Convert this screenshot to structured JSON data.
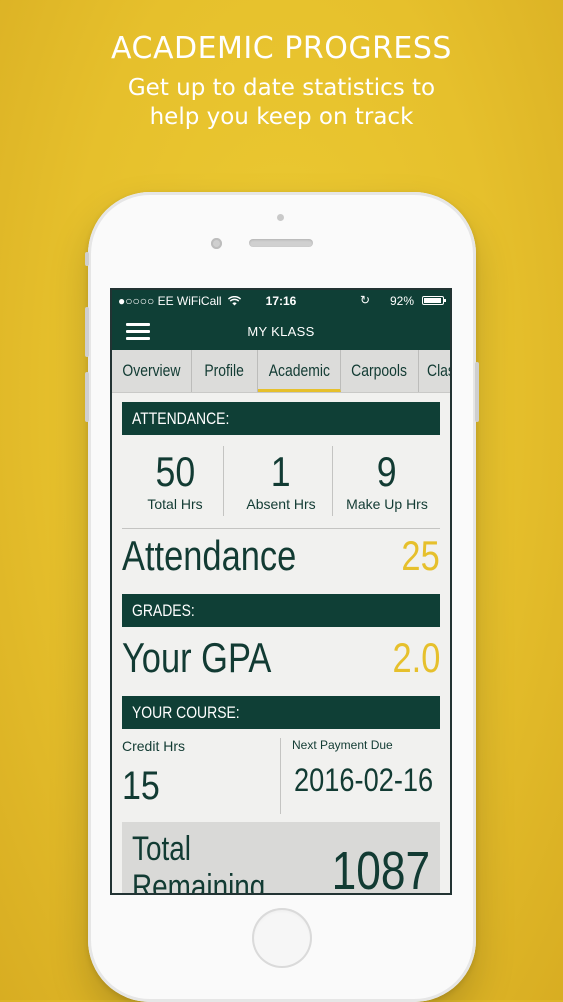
{
  "promo": {
    "headline": "ACADEMIC PROGRESS",
    "subline_1": "Get up to date statistics to",
    "subline_2": "help you keep on track"
  },
  "status_bar": {
    "carrier": "●○○○○ EE WiFiCall",
    "time": "17:16",
    "battery": "92%",
    "battery_level": 0.92
  },
  "nav": {
    "title": "MY KLASS",
    "menu_icon": "hamburger-menu-icon"
  },
  "tabs": [
    {
      "label": "Overview"
    },
    {
      "label": "Profile"
    },
    {
      "label": "Academic"
    },
    {
      "label": "Carpools"
    },
    {
      "label": "Clas"
    }
  ],
  "active_tab": "Academic",
  "attendance": {
    "heading": "ATTENDANCE:",
    "stats": [
      {
        "value": "50",
        "label": "Total Hrs"
      },
      {
        "value": "1",
        "label": "Absent Hrs"
      },
      {
        "value": "9",
        "label": "Make Up Hrs"
      }
    ],
    "summary_label": "Attendance",
    "summary_value": "25"
  },
  "grades": {
    "heading": "GRADES:",
    "gpa_label": "Your GPA",
    "gpa_value": "2.0"
  },
  "course": {
    "heading": "YOUR COURSE:",
    "credit_label": "Credit Hrs",
    "credit_value": "15",
    "payment_label": "Next Payment Due",
    "payment_value": "2016-02-16",
    "remaining_label": "Total Remaining Hours",
    "remaining_value": "1087"
  },
  "colors": {
    "background": "#e6c02c",
    "dark_green": "#0f3f36",
    "accent_yellow": "#e6c02c"
  }
}
